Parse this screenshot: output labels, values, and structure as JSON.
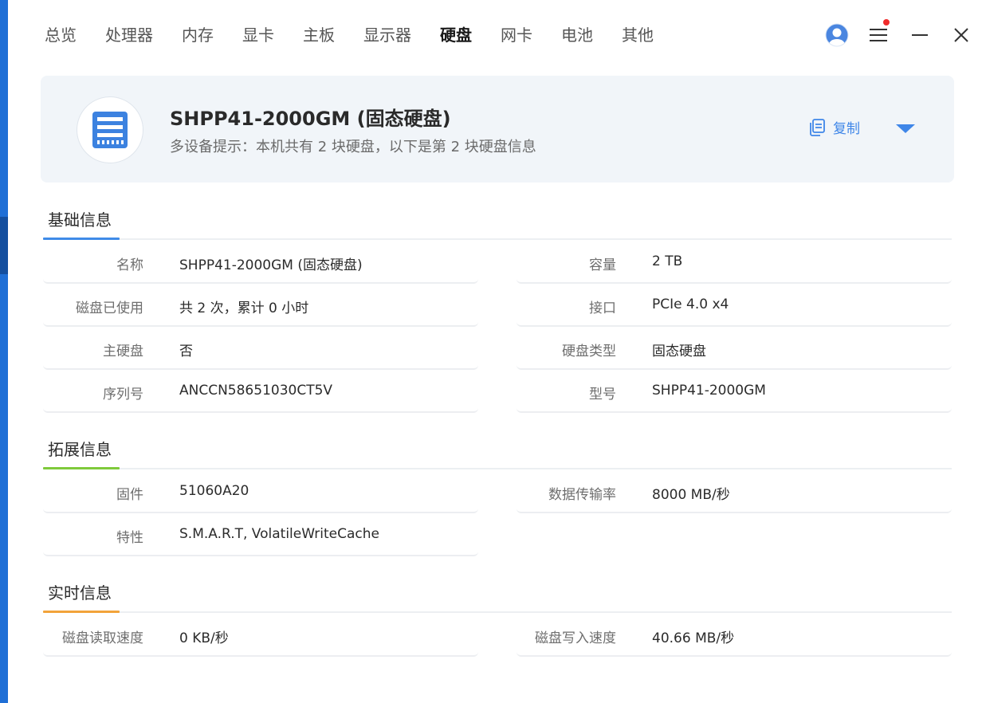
{
  "nav": {
    "items": [
      "总览",
      "处理器",
      "内存",
      "显卡",
      "主板",
      "显示器",
      "硬盘",
      "网卡",
      "电池",
      "其他"
    ],
    "active": "硬盘"
  },
  "window_controls": {
    "icons": [
      "user-avatar-icon",
      "menu-icon",
      "minimize-icon",
      "close-icon"
    ],
    "notification_dot_color": "#ef2b2b"
  },
  "header": {
    "title": "SHPP41-2000GM (固态硬盘)",
    "subtitle": "多设备提示：本机共有 2 块硬盘，以下是第 2 块硬盘信息",
    "copy_label": "复制",
    "icon": "disk-drive-icon"
  },
  "sections": {
    "basic": {
      "title": "基础信息",
      "accent_color": "#3f8be8",
      "rows": [
        {
          "label": "名称",
          "value": "SHPP41-2000GM (固态硬盘)"
        },
        {
          "label": "容量",
          "value": "2 TB"
        },
        {
          "label": "磁盘已使用",
          "value": "共 2 次，累计 0 小时"
        },
        {
          "label": "接口",
          "value": "PCIe 4.0 x4"
        },
        {
          "label": "主硬盘",
          "value": "否"
        },
        {
          "label": "硬盘类型",
          "value": "固态硬盘"
        },
        {
          "label": "序列号",
          "value": "ANCCN58651030CT5V"
        },
        {
          "label": "型号",
          "value": "SHPP41-2000GM"
        }
      ]
    },
    "extended": {
      "title": "拓展信息",
      "accent_color": "#7fca3b",
      "rows": [
        {
          "label": "固件",
          "value": "51060A20"
        },
        {
          "label": "数据传输率",
          "value": "8000 MB/秒"
        },
        {
          "label": "特性",
          "value": "S.M.A.R.T, VolatileWriteCache"
        }
      ]
    },
    "realtime": {
      "title": "实时信息",
      "accent_color": "#f2a33a",
      "rows": [
        {
          "label": "磁盘读取速度",
          "value": "0 KB/秒"
        },
        {
          "label": "磁盘写入速度",
          "value": "40.66 MB/秒"
        }
      ]
    }
  },
  "colors": {
    "accent_blue": "#3f86e8",
    "header_bg": "#f1f5f9"
  }
}
